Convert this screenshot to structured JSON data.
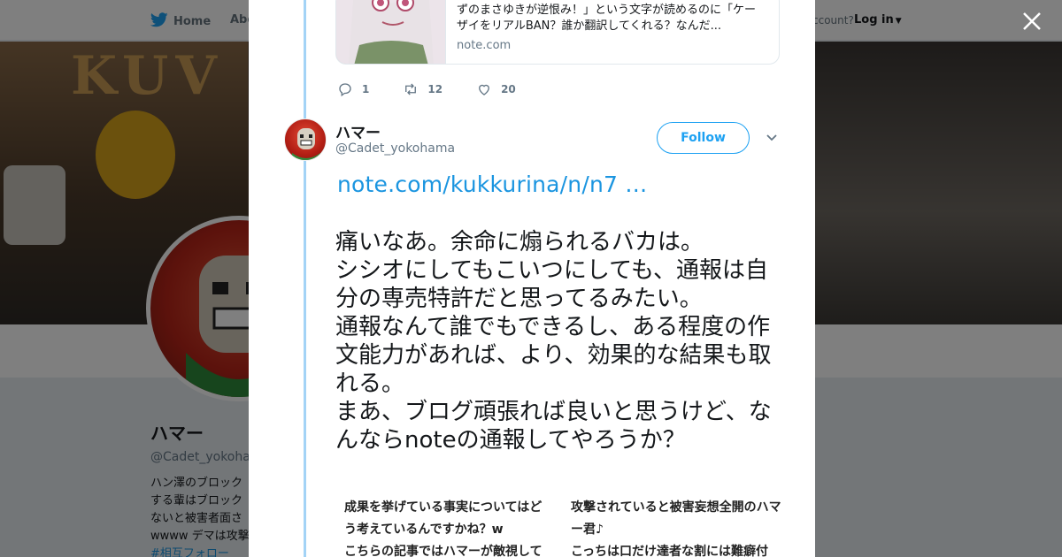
{
  "background": {
    "nav": {
      "home_label": "Home",
      "about_label": "Abo",
      "account_prompt": "ccount?",
      "login_label": "Log in"
    },
    "header_sign": "KUV",
    "profile": {
      "name": "ハマー",
      "handle": "@Cadet_yokohan",
      "bio_lines": [
        "ハン澤のブロック",
        "する輩はブロック",
        "ないと被害者面さ",
        "wwww デマは攻撃"
      ],
      "hashtag": "#相互フォロー"
    }
  },
  "close_label": "×",
  "previous_tweet": {
    "card": {
      "text": "ずのまさゆきが逆恨み！」という文字が読めるのに「ケーザイをリアルBAN？誰か翻訳してくれる？なんだ...",
      "domain": "note.com"
    },
    "actions": {
      "replies": "1",
      "retweets": "12",
      "likes": "20"
    }
  },
  "tweet": {
    "name": "ハマー",
    "handle": "@Cadet_yokohama",
    "follow_label": "Follow",
    "link_text": "note.com/kukkurina/n/n7  …",
    "body": "痛いなあ。余命に煽られるバカは。\nシシオにしてもこいつにしても、通報は自分の専売特許だと思ってるみたい。\n通報なんて誰でもできるし、ある程度の作文能力があれば、より、効果的な結果も取れる。\nまあ、ブログ頑張れば良いと思うけど、なんならnoteの通報してやろうか？",
    "image": {
      "left_text": "成果を挙げている事実についてはどう考えているんですかね？w\nこちらの記事ではハマーが敵視して",
      "right_text": "攻撃されていると被害妄想全開のハマー君♪\nこっちは口だけ達者な割には難癖付"
    }
  },
  "colors": {
    "accent": "#1da1f2",
    "link": "#1b95e0",
    "thread_line": "#a3d3f6",
    "muted": "#657786"
  }
}
